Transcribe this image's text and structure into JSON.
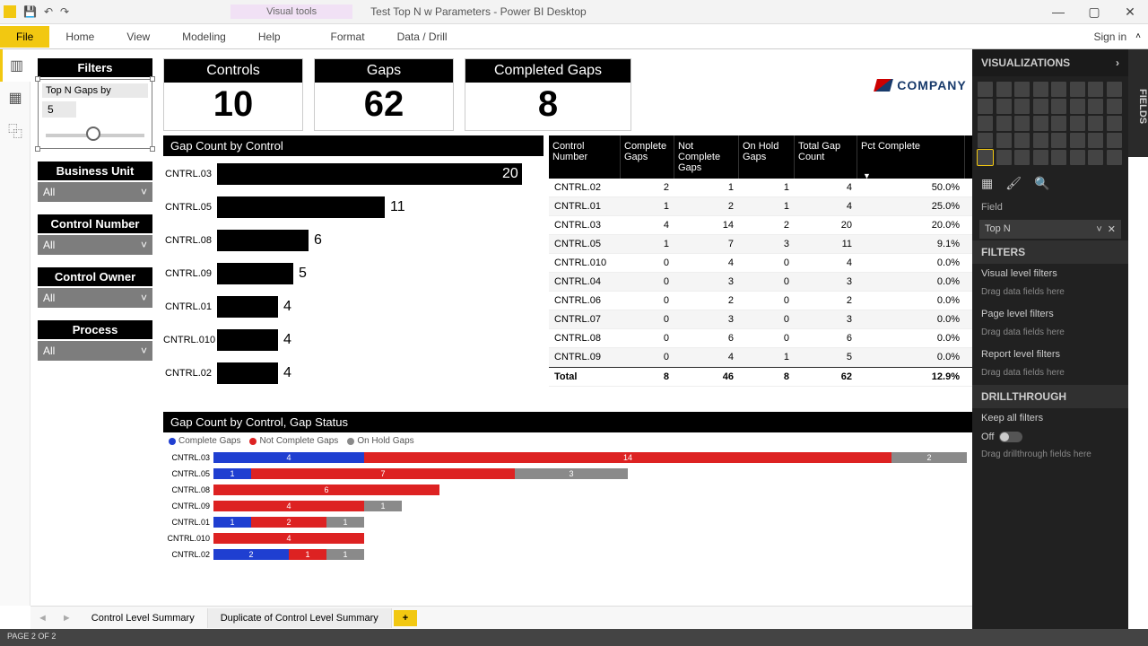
{
  "app": {
    "title": "Test Top N w Parameters - Power BI Desktop",
    "ctx_tab": "Visual tools",
    "signin": "Sign in",
    "status": "PAGE 2 OF 2"
  },
  "ribbon": {
    "file": "File",
    "tabs": [
      "Home",
      "View",
      "Modeling",
      "Help",
      "Format",
      "Data / Drill"
    ]
  },
  "filters": {
    "title": "Filters",
    "topn_label": "Top N Gaps by",
    "topn_value": "5",
    "groups": [
      {
        "label": "Business Unit",
        "value": "All"
      },
      {
        "label": "Control Number",
        "value": "All"
      },
      {
        "label": "Control Owner",
        "value": "All"
      },
      {
        "label": "Process",
        "value": "All"
      }
    ]
  },
  "kpi": [
    {
      "label": "Controls",
      "value": "10"
    },
    {
      "label": "Gaps",
      "value": "62"
    },
    {
      "label": "Completed Gaps",
      "value": "8"
    }
  ],
  "logo": "COMPANY",
  "chart_data": [
    {
      "type": "bar",
      "title": "Gap Count by Control",
      "categories": [
        "CNTRL.03",
        "CNTRL.05",
        "CNTRL.08",
        "CNTRL.09",
        "CNTRL.01",
        "CNTRL.010",
        "CNTRL.02"
      ],
      "values": [
        20,
        11,
        6,
        5,
        4,
        4,
        4
      ],
      "xlabel": "",
      "ylabel": "",
      "ylim": [
        0,
        20
      ]
    },
    {
      "type": "bar",
      "title": "Gap Count by Control, Gap Status",
      "categories": [
        "CNTRL.03",
        "CNTRL.05",
        "CNTRL.08",
        "CNTRL.09",
        "CNTRL.01",
        "CNTRL.010",
        "CNTRL.02"
      ],
      "series": [
        {
          "name": "Complete Gaps",
          "color": "#1f3fd1",
          "values": [
            4,
            1,
            0,
            0,
            1,
            0,
            2
          ]
        },
        {
          "name": "Not Complete Gaps",
          "color": "#d22",
          "values": [
            14,
            7,
            6,
            4,
            2,
            4,
            1
          ]
        },
        {
          "name": "On Hold Gaps",
          "color": "#8a8a8a",
          "values": [
            2,
            3,
            0,
            1,
            1,
            0,
            1
          ]
        }
      ],
      "xlabel": "",
      "ylabel": ""
    }
  ],
  "table": {
    "headers": [
      "Control Number",
      "Complete Gaps",
      "Not Complete Gaps",
      "On Hold Gaps",
      "Total Gap Count",
      "Pct Complete"
    ],
    "rows": [
      [
        "CNTRL.02",
        "2",
        "1",
        "1",
        "4",
        "50.0%"
      ],
      [
        "CNTRL.01",
        "1",
        "2",
        "1",
        "4",
        "25.0%"
      ],
      [
        "CNTRL.03",
        "4",
        "14",
        "2",
        "20",
        "20.0%"
      ],
      [
        "CNTRL.05",
        "1",
        "7",
        "3",
        "11",
        "9.1%"
      ],
      [
        "CNTRL.010",
        "0",
        "4",
        "0",
        "4",
        "0.0%"
      ],
      [
        "CNTRL.04",
        "0",
        "3",
        "0",
        "3",
        "0.0%"
      ],
      [
        "CNTRL.06",
        "0",
        "2",
        "0",
        "2",
        "0.0%"
      ],
      [
        "CNTRL.07",
        "0",
        "3",
        "0",
        "3",
        "0.0%"
      ],
      [
        "CNTRL.08",
        "0",
        "6",
        "0",
        "6",
        "0.0%"
      ],
      [
        "CNTRL.09",
        "0",
        "4",
        "1",
        "5",
        "0.0%"
      ]
    ],
    "total": [
      "Total",
      "8",
      "46",
      "8",
      "62",
      "12.9%"
    ]
  },
  "tabs": {
    "p1": "Control Level Summary",
    "p2": "Duplicate of Control Level Summary"
  },
  "rpanel": {
    "title": "VISUALIZATIONS",
    "field_label": "Field",
    "field_value": "Top N",
    "filters_title": "FILTERS",
    "vlf": "Visual level filters",
    "plf": "Page level filters",
    "rlf": "Report level filters",
    "drop": "Drag data fields here",
    "drill_title": "DRILLTHROUGH",
    "keep": "Keep all filters",
    "off": "Off",
    "drill_drop": "Drag drillthrough fields here",
    "fields_tab": "FIELDS"
  }
}
